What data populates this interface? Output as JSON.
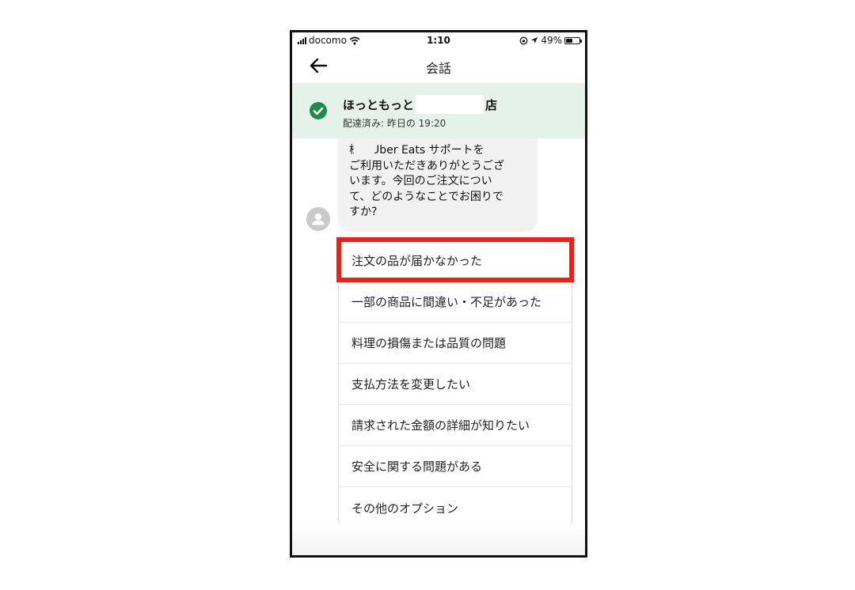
{
  "status_bar": {
    "carrier": "docomo",
    "time": "1:10",
    "battery_percent": 49,
    "battery_label": "49%",
    "icons": [
      "signal-icon",
      "wifi-icon",
      "orientation-lock-icon",
      "location-icon",
      "battery-icon"
    ]
  },
  "navbar": {
    "title": "会話",
    "back_icon": "arrow-left-icon"
  },
  "order_banner": {
    "store_name_prefix": "ほっともっと",
    "store_name_suffix": "店",
    "status": "配達済み: 昨日の 19:20",
    "icon": "check-circle-icon",
    "accent_color": "#1f8a4c",
    "background_color": "#e4f2ea"
  },
  "message": {
    "avatar_icon": "person-avatar-icon",
    "text": "様、Uber Eats サポートを\nご利用いただきありがとうござ\nいます。今回のご注文につい\nて、どのようなことでお困りで\nすか?"
  },
  "options": [
    "注文の品が届かなかった",
    "一部の商品に間違い・不足があった",
    "料理の損傷または品質の問題",
    "支払方法を変更したい",
    "請求された金額の詳細が知りたい",
    "安全に関する問題がある",
    "その他のオプション"
  ],
  "highlight": {
    "target_option_index": 0,
    "color": "#ee2016"
  }
}
